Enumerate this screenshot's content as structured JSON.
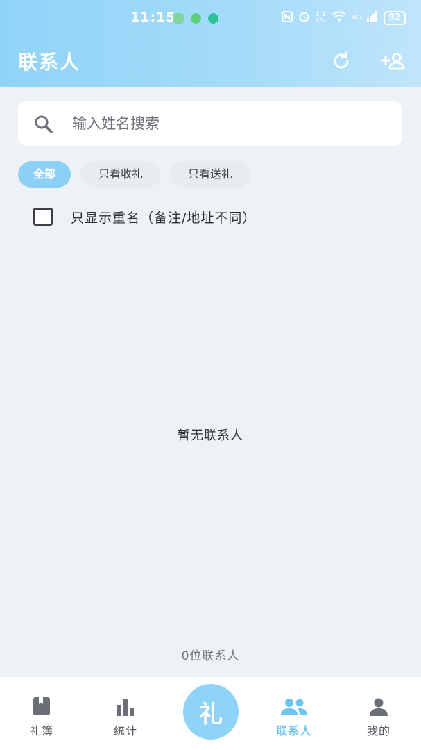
{
  "status_bar": {
    "time": "11:15",
    "net_speed": "1.3 K/s",
    "network_type": "4G",
    "battery": "92"
  },
  "header": {
    "title": "联系人",
    "refresh_icon": "refresh-icon",
    "add_contact_icon": "add-person-icon"
  },
  "search": {
    "placeholder": "输入姓名搜索",
    "value": ""
  },
  "filters": [
    {
      "label": "全部",
      "active": true
    },
    {
      "label": "只看收礼",
      "active": false
    },
    {
      "label": "只看送礼",
      "active": false
    }
  ],
  "duplicate_filter": {
    "label": "只显示重名（备注/地址不同）",
    "checked": false
  },
  "empty_text": "暂无联系人",
  "contact_count_text": "0位联系人",
  "tabbar": {
    "items": [
      {
        "label": "礼簿",
        "icon": "book-icon",
        "active": false
      },
      {
        "label": "统计",
        "icon": "bar-chart-icon",
        "active": false
      },
      {
        "label": "联系人",
        "icon": "people-icon",
        "active": true
      },
      {
        "label": "我的",
        "icon": "person-icon",
        "active": false
      }
    ],
    "center_label": "礼"
  },
  "colors": {
    "accent": "#8fd3f8",
    "active_tab": "#6ec4f0",
    "background": "#eef1f6"
  }
}
